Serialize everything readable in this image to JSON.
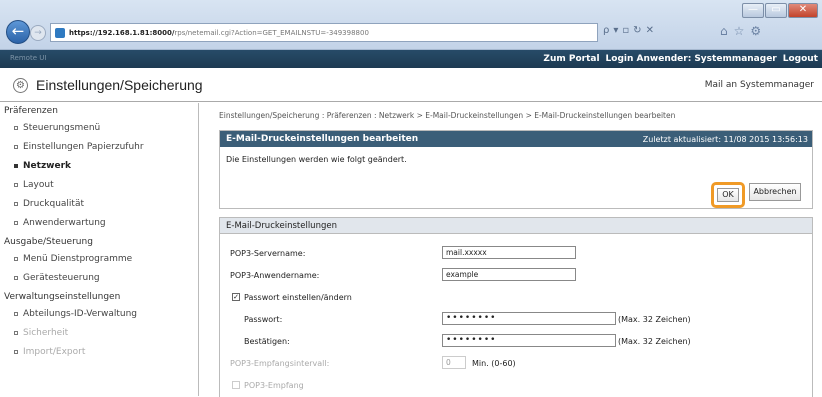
{
  "browser": {
    "url_host": "https://192.168.1.81:8000/",
    "url_rest": "rps/netemail.cgi?Action=GET_EMAILNSTU=-349398800",
    "search_label": "ρ",
    "window": {
      "minimize": "—",
      "maximize": "▭",
      "close": "✕"
    }
  },
  "topbar": {
    "left_text": "Remote UI",
    "portal": "Zum Portal",
    "login_label": "Login Anwender:",
    "user": "Systemmanager",
    "logout": "Logout"
  },
  "header": {
    "title": "Einstellungen/Speicherung",
    "mail_link": "Mail an Systemmanager"
  },
  "sidebar": {
    "sections": [
      {
        "title": "Präferenzen",
        "items": [
          {
            "label": "Steuerungsmenü",
            "selected": false
          },
          {
            "label": "Einstellungen Papierzufuhr",
            "selected": false
          },
          {
            "label": "Netzwerk",
            "selected": true
          },
          {
            "label": "Layout",
            "selected": false
          },
          {
            "label": "Druckqualität",
            "selected": false
          },
          {
            "label": "Anwenderwartung",
            "selected": false
          }
        ]
      },
      {
        "title": "Ausgabe/Steuerung",
        "items": [
          {
            "label": "Menü Dienstprogramme",
            "selected": false
          },
          {
            "label": "Gerätesteuerung",
            "selected": false
          }
        ]
      },
      {
        "title": "Verwaltungseinstellungen",
        "items": [
          {
            "label": "Abteilungs-ID-Verwaltung",
            "selected": false
          },
          {
            "label": "Sicherheit",
            "selected": false
          },
          {
            "label": "Import/Export",
            "selected": false
          }
        ]
      }
    ]
  },
  "main": {
    "breadcrumb": "Einstellungen/Speicherung : Präferenzen : Netzwerk > E-Mail-Druckeinstellungen > E-Mail-Druckeinstellungen bearbeiten",
    "edit_panel": {
      "title": "E-Mail-Druckeinstellungen bearbeiten",
      "timestamp": "Zuletzt aktualisiert: 11/08 2015 13:56:13",
      "message": "Die Einstellungen werden wie folgt geändert.",
      "ok_label": "OK",
      "cancel_label": "Abbrechen"
    },
    "settings": {
      "title": "E-Mail-Druckeinstellungen",
      "pop3_server_label": "POP3-Servername:",
      "pop3_server_value": "mail.xxxxx",
      "pop3_user_label": "POP3-Anwendername:",
      "pop3_user_value": "example",
      "set_password_label": "Passwort einstellen/ändern",
      "set_password_checked": true,
      "password_label": "Passwort:",
      "password_value": "••••••••",
      "password_hint": "(Max. 32 Zeichen)",
      "confirm_label": "Bestätigen:",
      "confirm_value": "••••••••",
      "confirm_hint": "(Max. 32 Zeichen)",
      "interval_label": "POP3-Empfangsintervall:",
      "interval_value": "0",
      "interval_hint": "Min. (0-60)",
      "pop3_receive_label": "POP3-Empfang"
    }
  }
}
